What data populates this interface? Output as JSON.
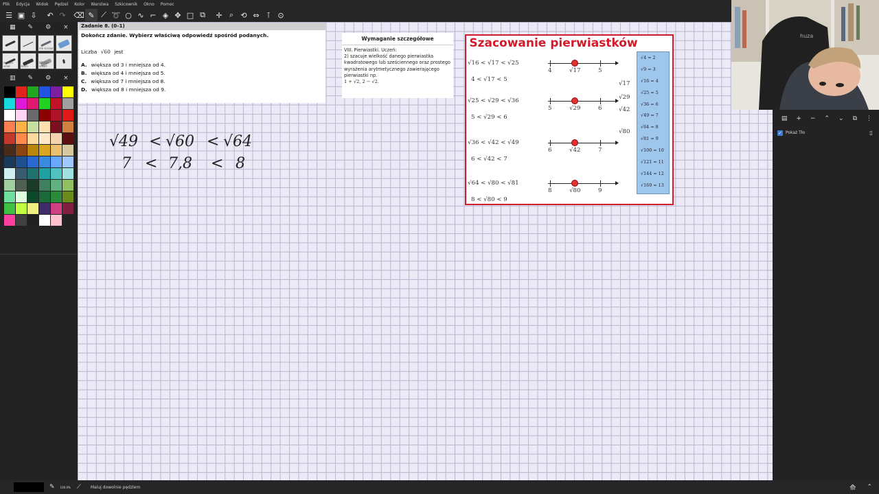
{
  "menu": [
    "Plik",
    "Edycja",
    "Widok",
    "Pędzel",
    "Kolor",
    "Warstwa",
    "Szkicownik",
    "Okno",
    "Pomoc"
  ],
  "toolbar_icons": [
    "menu-icon",
    "save-icon",
    "export-icon",
    "undo-icon",
    "redo-icon",
    "eraser-icon",
    "pen-icon",
    "pencil-icon",
    "lasso-icon",
    "circle-icon",
    "curve-icon",
    "eyedropper-icon",
    "fill-icon",
    "move-icon",
    "rectangle-icon",
    "transform-icon",
    "pan-icon",
    "zoom-icon",
    "rotate-icon",
    "flip-icon",
    "guide-icon",
    "settings-icon"
  ],
  "brushes": [
    {
      "label": ""
    },
    {
      "label": ""
    },
    {
      "label": "ink scissor"
    },
    {
      "label": ""
    },
    {
      "label": "marker smal"
    },
    {
      "label": "brish"
    },
    {
      "label": "BRUSH smart"
    },
    {
      "label": ""
    }
  ],
  "palette": [
    "#000000",
    "#e0231b",
    "#1fa71f",
    "#2154e0",
    "#7b1fa2",
    "#ffff00",
    "#19d9e0",
    "#e019d9",
    "#e01970",
    "#22d022",
    "#c1122a",
    "#a0a0a0",
    "#ffffff",
    "#ffd6f6",
    "#6a6a6a",
    "#8b0000",
    "#b0122a",
    "#e01919",
    "#ff7f50",
    "#ffb347",
    "#c6e0a0",
    "#ffe0b0",
    "#7a1020",
    "#d08040",
    "#c0392b",
    "#ff8a4c",
    "#fdd9a0",
    "#ffe8c8",
    "#f4d3b0",
    "#5a1010",
    "#4a2a1a",
    "#8b4513",
    "#b8860b",
    "#daa520",
    "#e8c070",
    "#d8c8a0",
    "#1b3a5a",
    "#1f4f8f",
    "#2a6ad0",
    "#3a8ae0",
    "#6aa8ff",
    "#a0c8ff",
    "#d0f0f0",
    "#3a5a70",
    "#207070",
    "#20a0a0",
    "#50c0c0",
    "#a0e0e0",
    "#a0d0a0",
    "#506050",
    "#1a3a2a",
    "#408060",
    "#60b080",
    "#90c060",
    "#70e0a0",
    "#e0ffe0",
    "#0a4a2a",
    "#1a6a3a",
    "#2a8a3a",
    "#6a8a1a",
    "#40c040",
    "#c0ff40",
    "#f0f080",
    "#402a6a",
    "#d04080",
    "#802040",
    "#ff40a0",
    "#404040",
    "#202020",
    "#ffffff",
    "#ffc0d0",
    ""
  ],
  "task": {
    "header": "Zadanie 8. (0–1)",
    "instruction": "Dokończ zdanie. Wybierz właściwą odpowiedź spośród podanych.",
    "question_prefix": "Liczba",
    "question_root": "√60",
    "question_suffix": "jest",
    "options": [
      {
        "letter": "A.",
        "text": "większa od  3  i mniejsza od  4."
      },
      {
        "letter": "B.",
        "text": "większa od  4  i mniejsza od  5."
      },
      {
        "letter": "C.",
        "text": "większa od  7  i mniejsza od  8."
      },
      {
        "letter": "D.",
        "text": "większa od  8  i mniejsza od  9."
      }
    ]
  },
  "requirement": {
    "title": "Wymaganie szczegółowe",
    "line1": "VIII. Pierwiastki. Uczeń:",
    "line2": "2) szacuje wielkość danego pierwiastka kwadratowego lub sześciennego oraz prostego wyrażenia arytmetycznego zawierającego pierwiastki np.",
    "example": "1 + √2,  2 − √2."
  },
  "estimation": {
    "title": "Szacowanie pierwiastków",
    "rows": [
      {
        "ineq": "√16  <  √17  <  √25",
        "ineq2": "4   <  √17  <   5",
        "left": "4",
        "mid": "√17",
        "right": "5"
      },
      {
        "ineq": "√25  <  √29  <  √36",
        "ineq2": "5   <  √29  <   6",
        "left": "5",
        "mid": "√29",
        "right": "6"
      },
      {
        "ineq": "√36  <  √42  <  √49",
        "ineq2": "6   <  √42  <   7",
        "left": "6",
        "mid": "√42",
        "right": "7"
      },
      {
        "ineq": "√64  <  √80  <  √81",
        "ineq2": "8   <  √80  <   9",
        "left": "8",
        "mid": "√80",
        "right": "9"
      }
    ],
    "pointers": [
      "√17",
      "√29",
      "√42",
      "√80"
    ],
    "squares": [
      "√4  =  2",
      "√9  =  3",
      "√16  =  4",
      "√25  =  5",
      "√36  =  6",
      "√49  =  7",
      "√64  =  8",
      "√81  =  9",
      "√100  =  10",
      "√121  =  11",
      "√144  =  12",
      "√169  =  13"
    ]
  },
  "handwriting": {
    "line1": [
      "√49",
      "<",
      "√60",
      "<",
      "√64"
    ],
    "line2": [
      "7",
      "<",
      "7,8",
      "<",
      "8"
    ]
  },
  "layers": {
    "toolbar_icons": [
      "layer-menu-icon",
      "add-layer-icon",
      "remove-layer-icon",
      "move-up-icon",
      "move-down-icon",
      "duplicate-icon",
      "properties-icon"
    ],
    "layer_name": "Pokaż Tło"
  },
  "status": {
    "text": "Maluj dowolnie pędzlem",
    "zoom": "100.0%"
  }
}
